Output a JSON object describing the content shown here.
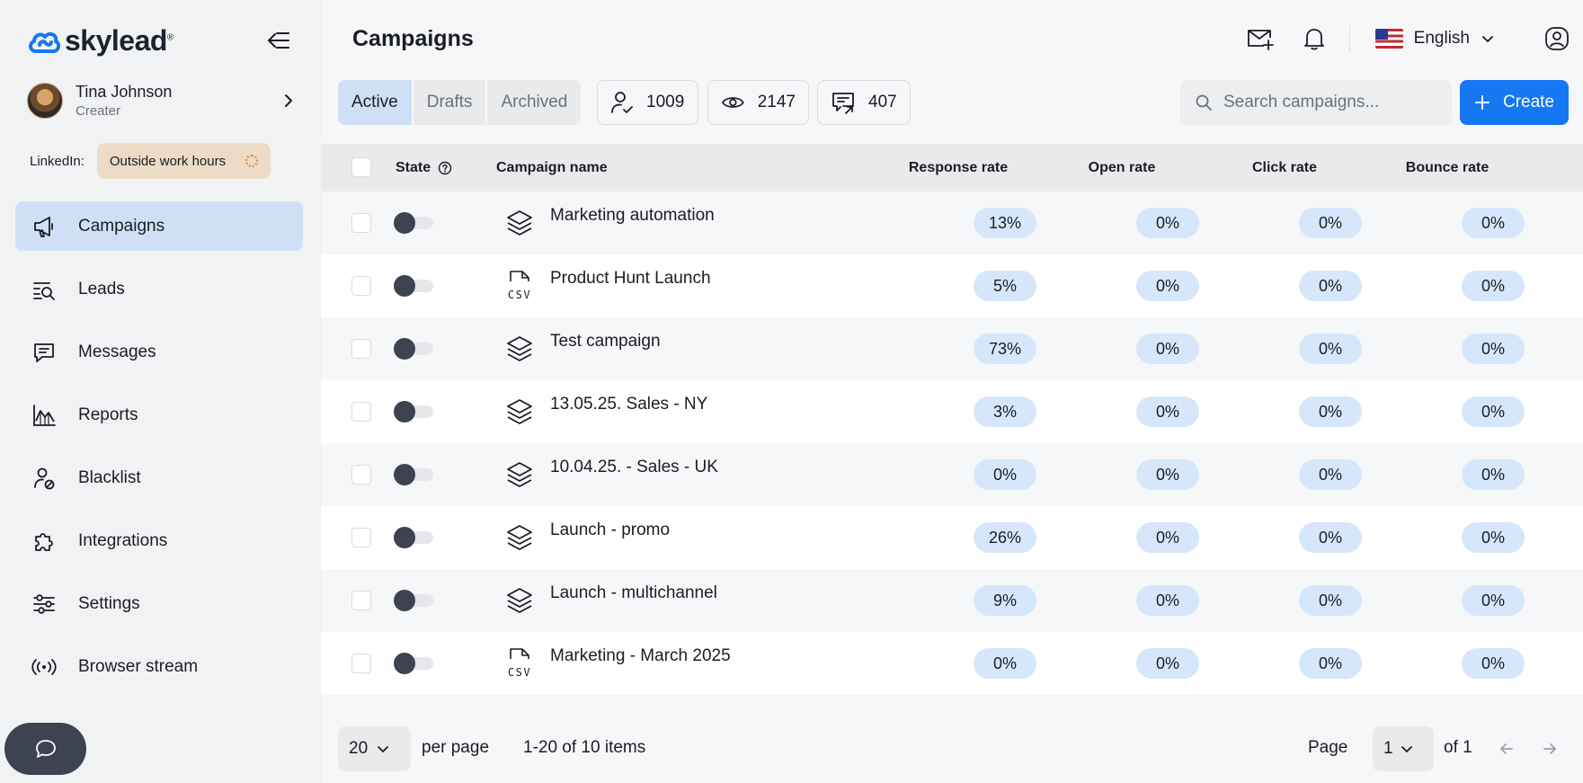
{
  "brand": {
    "name": "skylead",
    "mark": "®"
  },
  "user": {
    "name": "Tina Johnson",
    "role": "Creater"
  },
  "linkedin": {
    "label": "LinkedIn:",
    "status": "Outside work hours"
  },
  "nav": [
    {
      "label": "Campaigns",
      "icon": "megaphone-icon",
      "active": true
    },
    {
      "label": "Leads",
      "icon": "list-search-icon"
    },
    {
      "label": "Messages",
      "icon": "message-icon"
    },
    {
      "label": "Reports",
      "icon": "chart-icon"
    },
    {
      "label": "Blacklist",
      "icon": "user-block-icon"
    },
    {
      "label": "Integrations",
      "icon": "puzzle-icon"
    },
    {
      "label": "Settings",
      "icon": "sliders-icon"
    },
    {
      "label": "Browser stream",
      "icon": "broadcast-icon"
    }
  ],
  "header": {
    "title": "Campaigns",
    "language": "English"
  },
  "tabs": [
    "Active",
    "Drafts",
    "Archived"
  ],
  "stats": {
    "leads": "1009",
    "views": "2147",
    "replies": "407"
  },
  "search": {
    "placeholder": "Search campaigns..."
  },
  "create_label": "Create",
  "table": {
    "columns": {
      "state": "State",
      "name": "Campaign name",
      "response": "Response rate",
      "open": "Open rate",
      "click": "Click rate",
      "bounce": "Bounce rate"
    },
    "rows": [
      {
        "name": "Marketing automation",
        "type": "layers",
        "response": "13%",
        "open": "0%",
        "click": "0%",
        "bounce": "0%"
      },
      {
        "name": "Product Hunt Launch",
        "type": "csv",
        "response": "5%",
        "open": "0%",
        "click": "0%",
        "bounce": "0%"
      },
      {
        "name": "Test campaign",
        "type": "layers",
        "response": "73%",
        "open": "0%",
        "click": "0%",
        "bounce": "0%"
      },
      {
        "name": "13.05.25. Sales - NY",
        "type": "layers",
        "response": "3%",
        "open": "0%",
        "click": "0%",
        "bounce": "0%"
      },
      {
        "name": "10.04.25. - Sales - UK",
        "type": "layers",
        "response": "0%",
        "open": "0%",
        "click": "0%",
        "bounce": "0%"
      },
      {
        "name": "Launch - promo",
        "type": "layers",
        "response": "26%",
        "open": "0%",
        "click": "0%",
        "bounce": "0%"
      },
      {
        "name": "Launch - multichannel",
        "type": "layers",
        "response": "9%",
        "open": "0%",
        "click": "0%",
        "bounce": "0%"
      },
      {
        "name": "Marketing - March 2025",
        "type": "csv",
        "response": "0%",
        "open": "0%",
        "click": "0%",
        "bounce": "0%"
      }
    ]
  },
  "footer": {
    "per_page_value": "20",
    "per_page_label": "per page",
    "items_summary": "1-20 of 10 items",
    "page_label": "Page",
    "page_value": "1",
    "of_label": "of 1"
  },
  "colors": {
    "accent": "#1677f2",
    "active_nav": "#cfe0f6",
    "pill": "#d6e7fb",
    "status_pill": "#ecdcc6"
  }
}
